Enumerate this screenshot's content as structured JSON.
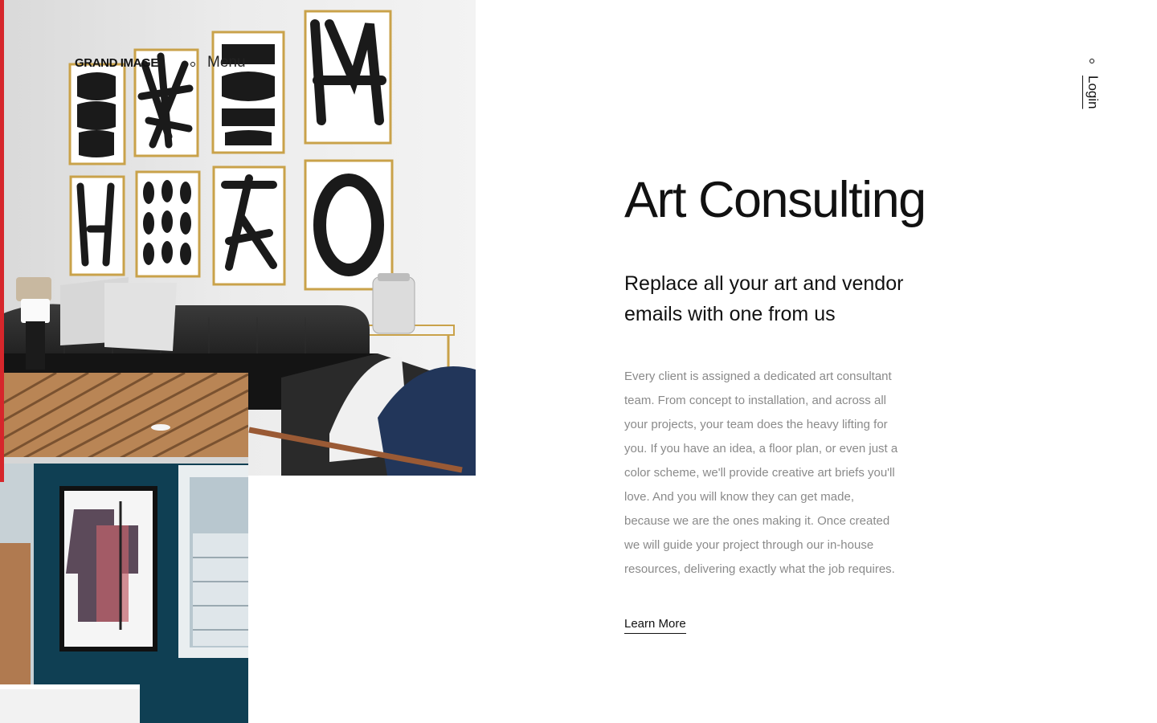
{
  "header": {
    "logo": "GRAND IMAGE",
    "menu_label": "Menu",
    "login_label": "Login"
  },
  "main": {
    "title": "Art Consulting",
    "subtitle": "Replace all your art and vendor emails with one from us",
    "body": "Every client is assigned a dedicated art consultant team. From concept to installation, and across all your projects, your team does the heavy lifting for you. If you have an idea, a floor plan, or even just a color scheme, we'll provide creative art briefs you'll love. And you will know they can get made, because we are the ones making it. Once created we will guide your project through our in-house resources, delivering exactly what the job requires.",
    "cta_label": "Learn More"
  },
  "images": {
    "living_room": "living-room-art-wall-photo",
    "lobby": "lobby-blue-wall-artwork-photo"
  },
  "colors": {
    "accent_red": "#d6262b",
    "text_dark": "#111111",
    "text_muted": "#8a8a8a",
    "lobby_wall": "#0f3f53"
  }
}
